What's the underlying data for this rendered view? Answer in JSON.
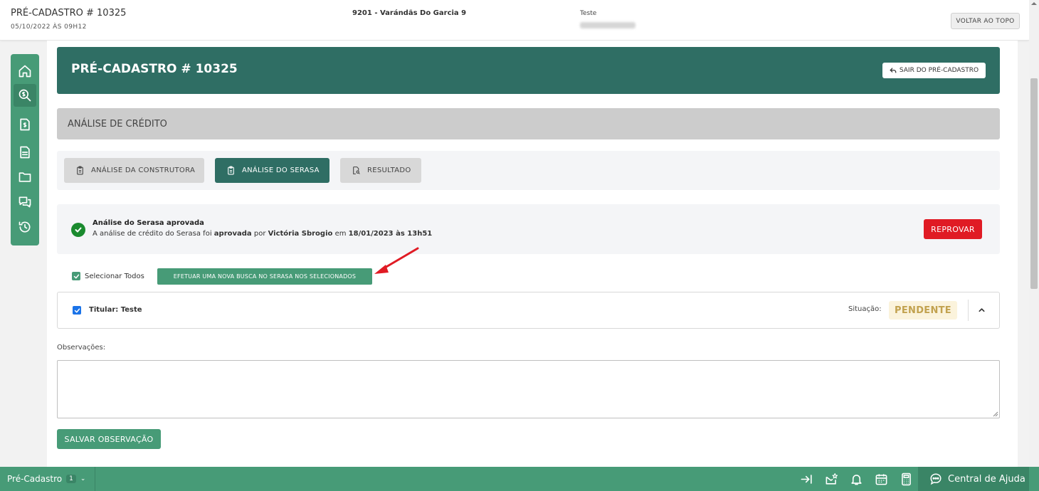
{
  "header": {
    "title": "PRÉ-CADASTRO # 10325",
    "date": "05/10/2022 ÀS 09H12",
    "enterprise": "9201 - Varándãs Do Garcia 9",
    "user_name": "Teste",
    "back_to_top": "VOLTAR AO TOPO"
  },
  "sidebar": {
    "items": [
      {
        "icon": "home-icon"
      },
      {
        "icon": "money-search-icon",
        "active": true
      },
      {
        "icon": "invoice-icon"
      },
      {
        "icon": "document-icon"
      },
      {
        "icon": "folder-icon"
      },
      {
        "icon": "chat-icon"
      },
      {
        "icon": "history-icon"
      }
    ]
  },
  "banner": {
    "title": "PRÉ-CADASTRO # 10325",
    "exit_button": "SAIR DO PRÉ-CADASTRO"
  },
  "section": {
    "title": "ANÁLISE DE CRÉDITO"
  },
  "tabs": [
    {
      "label": "ANÁLISE DA CONSTRUTORA",
      "active": false
    },
    {
      "label": "ANÁLISE DO SERASA",
      "active": true
    },
    {
      "label": "RESULTADO",
      "active": false
    }
  ],
  "approval": {
    "title": "Análise do Serasa aprovada",
    "text_prefix": "A análise de crédito do Serasa foi ",
    "status_word": "aprovada",
    "text_by": " por ",
    "approver": "Victória Sbrogio",
    "text_on": " em ",
    "datetime": "18/01/2023 às 13h51",
    "reject_button": "REPROVAR"
  },
  "selection": {
    "select_all_label": "Selecionar Todos",
    "select_all_checked": true,
    "new_search_button": "EFETUAR UMA NOVA BUSCA NO SERASA NOS SELECIONADOS"
  },
  "titular": {
    "label": "Titular: Teste",
    "checked": true,
    "status_label": "Situação:",
    "status_value": "PENDENTE"
  },
  "observations": {
    "label": "Observações:",
    "value": "",
    "save_button": "SALVAR OBSERVAÇÃO"
  },
  "bottombar": {
    "module_label": "Pré-Cadastro",
    "module_count": "1",
    "help_label": "Central de Ajuda"
  },
  "colors": {
    "primary_green": "#479b77",
    "dark_teal": "#2f6e64",
    "danger_red": "#e01b24",
    "pending_text": "#c2a24f"
  }
}
